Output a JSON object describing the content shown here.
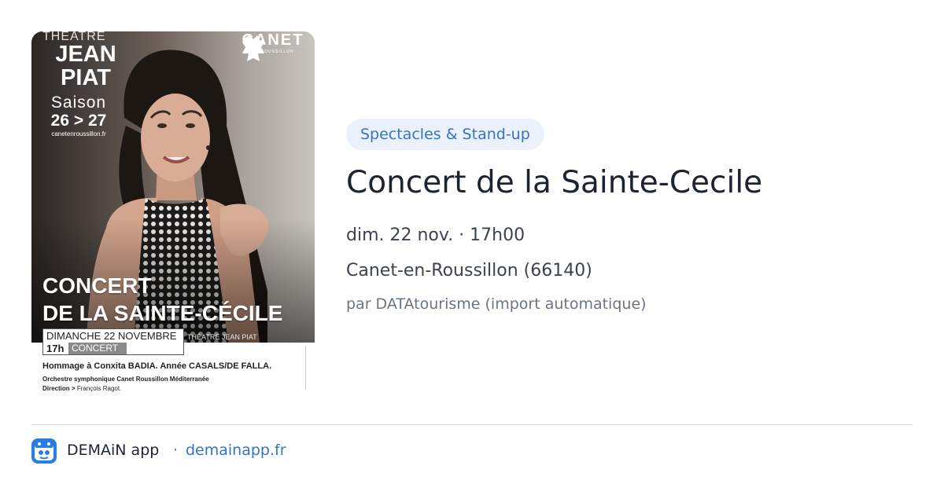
{
  "poster": {
    "theatre": "THÉATRE",
    "jean_piat": "JEAN PIAT",
    "saison": "Saison",
    "years": "26 > 27",
    "site": "canetenroussillon.fr",
    "logo_text": "CANET",
    "logo_sub": "EN ROUSSILLON",
    "title_line1": "CONCERT",
    "title_line2": "DE LA SAINTE-CÉCILE",
    "date": "DIMANCHE 22 NOVEMBRE",
    "hour": "17h",
    "concert": "CONCERT",
    "venue": "THÉATRE JEAN PIAT",
    "hommage": "Hommage à Conxita BADIA. Année CASALS/DE FALLA.",
    "orchestre": "Orchestre symphonique Canet Roussillon Méditerranée",
    "direction_label": "Direction >",
    "direction_name": "François Ragot."
  },
  "event": {
    "category": "Spectacles & Stand-up",
    "title": "Concert de la Sainte-Cecile",
    "datetime": "dim. 22 nov. · 17h00",
    "location": "Canet-en-Roussillon (66140)",
    "source": "par DATAtourisme (import automatique)"
  },
  "footer": {
    "app_icon": "demain-app-icon",
    "app_name": "DEMAiN app",
    "separator": "·",
    "link": "demainapp.fr"
  },
  "colors": {
    "accent": "#3374c6",
    "badge_bg": "#eaf1fb",
    "title": "#1c2331",
    "muted": "#6b7482",
    "app_icon_bg": "#2a7de1"
  }
}
